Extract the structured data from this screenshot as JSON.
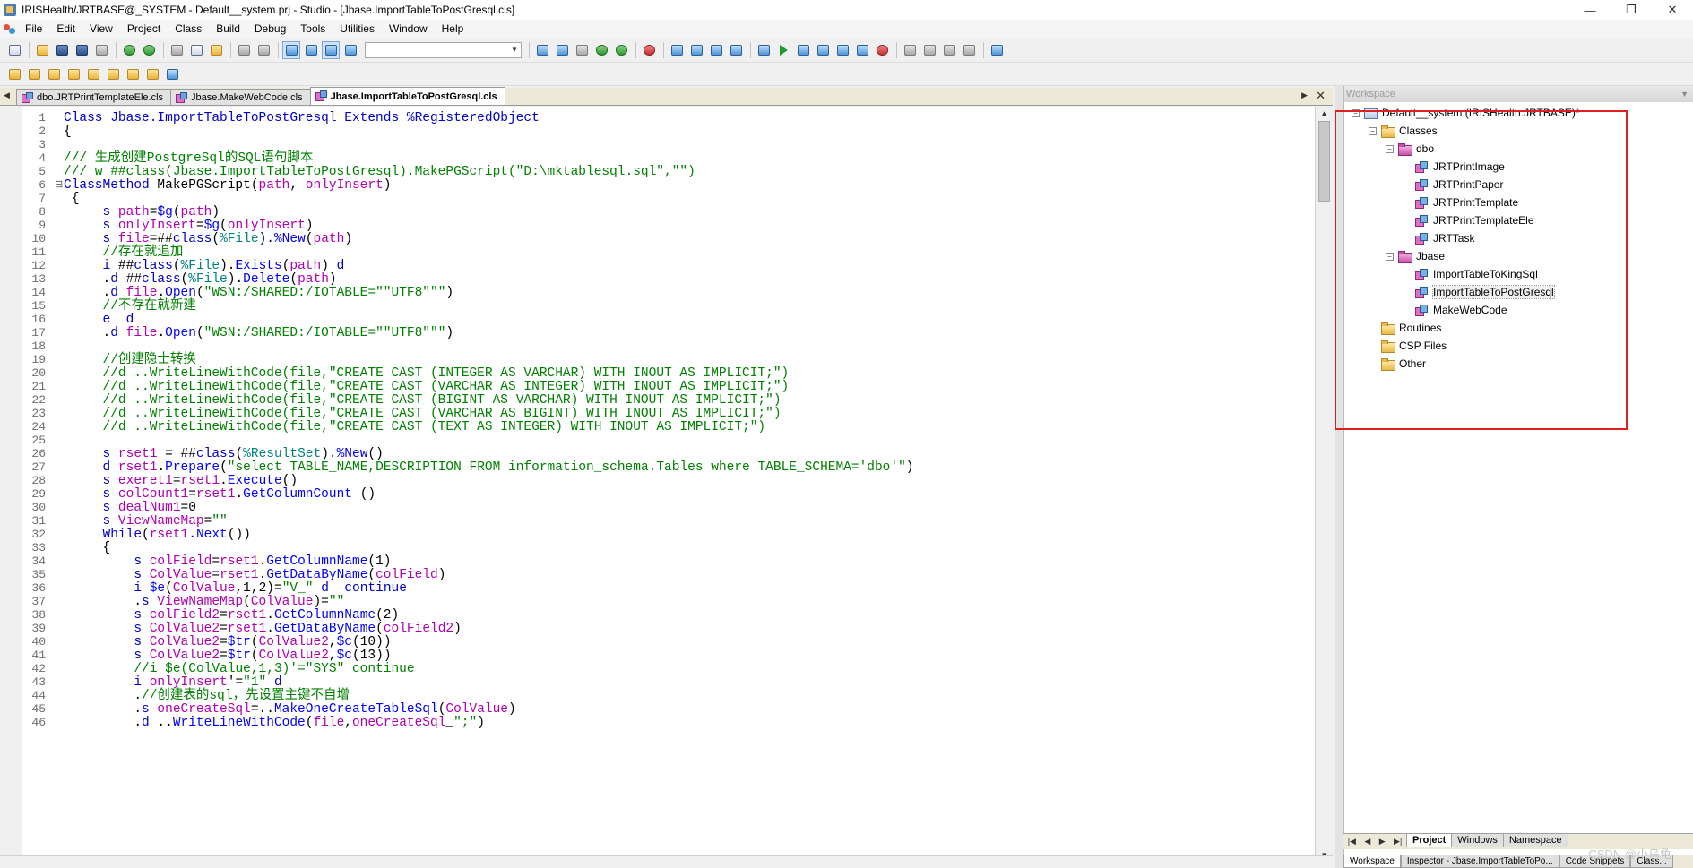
{
  "window": {
    "title": "IRISHealth/JRTBASE@_SYSTEM - Default__system.prj - Studio - [Jbase.ImportTableToPostGresql.cls]",
    "minimize": "—",
    "restore": "❐",
    "close": "✕"
  },
  "menu": [
    "File",
    "Edit",
    "View",
    "Project",
    "Class",
    "Build",
    "Debug",
    "Tools",
    "Utilities",
    "Window",
    "Help"
  ],
  "editor_tabs": [
    {
      "label": "dbo.JRTPrintTemplateEle.cls",
      "active": false
    },
    {
      "label": "Jbase.MakeWebCode.cls",
      "active": false
    },
    {
      "label": "Jbase.ImportTableToPostGresql.cls",
      "active": true
    }
  ],
  "workspace": {
    "header": "Workspace",
    "tree": [
      {
        "label": "Default__system  (IRISHealth:JRTBASE)*",
        "level": 0,
        "icon": "project-icon",
        "expander": "⊟"
      },
      {
        "label": "Classes",
        "level": 1,
        "icon": "folder-icon",
        "expander": "⊟"
      },
      {
        "label": "dbo",
        "level": 2,
        "icon": "package-icon",
        "expander": "⊟"
      },
      {
        "label": "JRTPrintImage",
        "level": 3,
        "icon": "class-icon"
      },
      {
        "label": "JRTPrintPaper",
        "level": 3,
        "icon": "class-icon"
      },
      {
        "label": "JRTPrintTemplate",
        "level": 3,
        "icon": "class-icon"
      },
      {
        "label": "JRTPrintTemplateEle",
        "level": 3,
        "icon": "class-icon"
      },
      {
        "label": "JRTTask",
        "level": 3,
        "icon": "class-icon"
      },
      {
        "label": "Jbase",
        "level": 2,
        "icon": "package-icon",
        "expander": "⊟"
      },
      {
        "label": "ImportTableToKingSql",
        "level": 3,
        "icon": "class-icon"
      },
      {
        "label": "ImportTableToPostGresql",
        "level": 3,
        "icon": "class-icon",
        "selected": true
      },
      {
        "label": "MakeWebCode",
        "level": 3,
        "icon": "class-icon"
      },
      {
        "label": "Routines",
        "level": 1,
        "icon": "folder-icon"
      },
      {
        "label": "CSP Files",
        "level": 1,
        "icon": "folder-icon"
      },
      {
        "label": "Other",
        "level": 1,
        "icon": "folder-icon"
      }
    ],
    "bottom_tabs": [
      {
        "label": "Project",
        "active": true
      },
      {
        "label": "Windows",
        "active": false
      },
      {
        "label": "Namespace",
        "active": false
      }
    ],
    "panel_tabs": [
      {
        "label": "Workspace",
        "active": true
      },
      {
        "label": "Inspector - Jbase.ImportTableToPo...",
        "active": false
      },
      {
        "label": "Code Snippets",
        "active": false
      },
      {
        "label": "Class...",
        "active": false
      }
    ]
  },
  "watermark": "CSDN @小乌龟",
  "code_lines": [
    [
      [
        "k",
        "Class Jbase.ImportTableToPostGresql Extends %RegisteredObject"
      ]
    ],
    [
      [
        "n",
        "{"
      ]
    ],
    [],
    [
      [
        "c",
        "/// 生成创建PostgreSql的SQL语句脚本"
      ]
    ],
    [
      [
        "c",
        "/// w ##class(Jbase.ImportTableToPostGresql).MakePGScript(\"D:\\mktablesql.sql\",\"\")"
      ]
    ],
    [
      [
        "k",
        "ClassMethod "
      ],
      [
        "n",
        "MakePGScript("
      ],
      [
        "v",
        "path"
      ],
      [
        "n",
        ", "
      ],
      [
        "v",
        "onlyInsert"
      ],
      [
        "n",
        ")"
      ]
    ],
    [
      [
        "n",
        " {"
      ]
    ],
    [
      [
        "n",
        "     "
      ],
      [
        "k",
        "s "
      ],
      [
        "v",
        "path"
      ],
      [
        "n",
        "="
      ],
      [
        "m",
        "$g"
      ],
      [
        "n",
        "("
      ],
      [
        "v",
        "path"
      ],
      [
        "n",
        ")"
      ]
    ],
    [
      [
        "n",
        "     "
      ],
      [
        "k",
        "s "
      ],
      [
        "v",
        "onlyInsert"
      ],
      [
        "n",
        "="
      ],
      [
        "m",
        "$g"
      ],
      [
        "n",
        "("
      ],
      [
        "v",
        "onlyInsert"
      ],
      [
        "n",
        ")"
      ]
    ],
    [
      [
        "n",
        "     "
      ],
      [
        "k",
        "s "
      ],
      [
        "v",
        "file"
      ],
      [
        "n",
        "=##"
      ],
      [
        "k",
        "class"
      ],
      [
        "n",
        "("
      ],
      [
        "f",
        "%File"
      ],
      [
        "n",
        ")."
      ],
      [
        "m",
        "%New"
      ],
      [
        "n",
        "("
      ],
      [
        "v",
        "path"
      ],
      [
        "n",
        ")"
      ]
    ],
    [
      [
        "n",
        "     "
      ],
      [
        "c",
        "//存在就追加"
      ]
    ],
    [
      [
        "n",
        "     "
      ],
      [
        "k",
        "i "
      ],
      [
        "n",
        "##"
      ],
      [
        "k",
        "class"
      ],
      [
        "n",
        "("
      ],
      [
        "f",
        "%File"
      ],
      [
        "n",
        ")."
      ],
      [
        "m",
        "Exists"
      ],
      [
        "n",
        "("
      ],
      [
        "v",
        "path"
      ],
      [
        "n",
        ") "
      ],
      [
        "k",
        "d"
      ]
    ],
    [
      [
        "n",
        "     ."
      ],
      [
        "k",
        "d "
      ],
      [
        "n",
        "##"
      ],
      [
        "k",
        "class"
      ],
      [
        "n",
        "("
      ],
      [
        "f",
        "%File"
      ],
      [
        "n",
        ")."
      ],
      [
        "m",
        "Delete"
      ],
      [
        "n",
        "("
      ],
      [
        "v",
        "path"
      ],
      [
        "n",
        ")"
      ]
    ],
    [
      [
        "n",
        "     ."
      ],
      [
        "k",
        "d "
      ],
      [
        "v",
        "file"
      ],
      [
        "n",
        "."
      ],
      [
        "m",
        "Open"
      ],
      [
        "n",
        "("
      ],
      [
        "s",
        "\"WSN:/SHARED:/IOTABLE=\"\"UTF8\"\"\""
      ],
      [
        "n",
        ")"
      ]
    ],
    [
      [
        "n",
        "     "
      ],
      [
        "c",
        "//不存在就新建"
      ]
    ],
    [
      [
        "n",
        "     "
      ],
      [
        "k",
        "e  d"
      ]
    ],
    [
      [
        "n",
        "     ."
      ],
      [
        "k",
        "d "
      ],
      [
        "v",
        "file"
      ],
      [
        "n",
        "."
      ],
      [
        "m",
        "Open"
      ],
      [
        "n",
        "("
      ],
      [
        "s",
        "\"WSN:/SHARED:/IOTABLE=\"\"UTF8\"\"\""
      ],
      [
        "n",
        ")"
      ]
    ],
    [],
    [
      [
        "n",
        "     "
      ],
      [
        "c",
        "//创建隐士转换"
      ]
    ],
    [
      [
        "n",
        "     "
      ],
      [
        "c",
        "//d ..WriteLineWithCode(file,\"CREATE CAST (INTEGER AS VARCHAR) WITH INOUT AS IMPLICIT;\")"
      ]
    ],
    [
      [
        "n",
        "     "
      ],
      [
        "c",
        "//d ..WriteLineWithCode(file,\"CREATE CAST (VARCHAR AS INTEGER) WITH INOUT AS IMPLICIT;\")"
      ]
    ],
    [
      [
        "n",
        "     "
      ],
      [
        "c",
        "//d ..WriteLineWithCode(file,\"CREATE CAST (BIGINT AS VARCHAR) WITH INOUT AS IMPLICIT;\")"
      ]
    ],
    [
      [
        "n",
        "     "
      ],
      [
        "c",
        "//d ..WriteLineWithCode(file,\"CREATE CAST (VARCHAR AS BIGINT) WITH INOUT AS IMPLICIT;\")"
      ]
    ],
    [
      [
        "n",
        "     "
      ],
      [
        "c",
        "//d ..WriteLineWithCode(file,\"CREATE CAST (TEXT AS INTEGER) WITH INOUT AS IMPLICIT;\")"
      ]
    ],
    [],
    [
      [
        "n",
        "     "
      ],
      [
        "k",
        "s "
      ],
      [
        "v",
        "rset1"
      ],
      [
        "n",
        " = ##"
      ],
      [
        "k",
        "class"
      ],
      [
        "n",
        "("
      ],
      [
        "f",
        "%ResultSet"
      ],
      [
        "n",
        ")."
      ],
      [
        "m",
        "%New"
      ],
      [
        "n",
        "()"
      ]
    ],
    [
      [
        "n",
        "     "
      ],
      [
        "k",
        "d "
      ],
      [
        "v",
        "rset1"
      ],
      [
        "n",
        "."
      ],
      [
        "m",
        "Prepare"
      ],
      [
        "n",
        "("
      ],
      [
        "s",
        "\"select TABLE_NAME,DESCRIPTION FROM information_schema.Tables where TABLE_SCHEMA='dbo'\""
      ],
      [
        "n",
        ")"
      ]
    ],
    [
      [
        "n",
        "     "
      ],
      [
        "k",
        "s "
      ],
      [
        "v",
        "exeret1"
      ],
      [
        "n",
        "="
      ],
      [
        "v",
        "rset1"
      ],
      [
        "n",
        "."
      ],
      [
        "m",
        "Execute"
      ],
      [
        "n",
        "()"
      ]
    ],
    [
      [
        "n",
        "     "
      ],
      [
        "k",
        "s "
      ],
      [
        "v",
        "colCount1"
      ],
      [
        "n",
        "="
      ],
      [
        "v",
        "rset1"
      ],
      [
        "n",
        "."
      ],
      [
        "m",
        "GetColumnCount"
      ],
      [
        "n",
        " ()"
      ]
    ],
    [
      [
        "n",
        "     "
      ],
      [
        "k",
        "s "
      ],
      [
        "v",
        "dealNum1"
      ],
      [
        "n",
        "=0"
      ]
    ],
    [
      [
        "n",
        "     "
      ],
      [
        "k",
        "s "
      ],
      [
        "v",
        "ViewNameMap"
      ],
      [
        "n",
        "="
      ],
      [
        "s",
        "\"\""
      ]
    ],
    [
      [
        "n",
        "     "
      ],
      [
        "k",
        "While"
      ],
      [
        "n",
        "("
      ],
      [
        "v",
        "rset1"
      ],
      [
        "n",
        "."
      ],
      [
        "m",
        "Next"
      ],
      [
        "n",
        "())"
      ]
    ],
    [
      [
        "n",
        "     {"
      ]
    ],
    [
      [
        "n",
        "         "
      ],
      [
        "k",
        "s "
      ],
      [
        "v",
        "colField"
      ],
      [
        "n",
        "="
      ],
      [
        "v",
        "rset1"
      ],
      [
        "n",
        "."
      ],
      [
        "m",
        "GetColumnName"
      ],
      [
        "n",
        "(1)"
      ]
    ],
    [
      [
        "n",
        "         "
      ],
      [
        "k",
        "s "
      ],
      [
        "v",
        "ColValue"
      ],
      [
        "n",
        "="
      ],
      [
        "v",
        "rset1"
      ],
      [
        "n",
        "."
      ],
      [
        "m",
        "GetDataByName"
      ],
      [
        "n",
        "("
      ],
      [
        "v",
        "colField"
      ],
      [
        "n",
        ")"
      ]
    ],
    [
      [
        "n",
        "         "
      ],
      [
        "k",
        "i "
      ],
      [
        "m",
        "$e"
      ],
      [
        "n",
        "("
      ],
      [
        "v",
        "ColValue"
      ],
      [
        "n",
        ",1,2)="
      ],
      [
        "s",
        "\"V_\""
      ],
      [
        "n",
        " "
      ],
      [
        "k",
        "d"
      ],
      [
        "n",
        "  "
      ],
      [
        "k",
        "continue"
      ]
    ],
    [
      [
        "n",
        "         ."
      ],
      [
        "k",
        "s "
      ],
      [
        "v",
        "ViewNameMap"
      ],
      [
        "n",
        "("
      ],
      [
        "v",
        "ColValue"
      ],
      [
        "n",
        ")="
      ],
      [
        "s",
        "\"\""
      ]
    ],
    [
      [
        "n",
        "         "
      ],
      [
        "k",
        "s "
      ],
      [
        "v",
        "colField2"
      ],
      [
        "n",
        "="
      ],
      [
        "v",
        "rset1"
      ],
      [
        "n",
        "."
      ],
      [
        "m",
        "GetColumnName"
      ],
      [
        "n",
        "(2)"
      ]
    ],
    [
      [
        "n",
        "         "
      ],
      [
        "k",
        "s "
      ],
      [
        "v",
        "ColValue2"
      ],
      [
        "n",
        "="
      ],
      [
        "v",
        "rset1"
      ],
      [
        "n",
        "."
      ],
      [
        "m",
        "GetDataByName"
      ],
      [
        "n",
        "("
      ],
      [
        "v",
        "colField2"
      ],
      [
        "n",
        ")"
      ]
    ],
    [
      [
        "n",
        "         "
      ],
      [
        "k",
        "s "
      ],
      [
        "v",
        "ColValue2"
      ],
      [
        "n",
        "="
      ],
      [
        "m",
        "$tr"
      ],
      [
        "n",
        "("
      ],
      [
        "v",
        "ColValue2"
      ],
      [
        "n",
        ","
      ],
      [
        "m",
        "$c"
      ],
      [
        "n",
        "(10))"
      ]
    ],
    [
      [
        "n",
        "         "
      ],
      [
        "k",
        "s "
      ],
      [
        "v",
        "ColValue2"
      ],
      [
        "n",
        "="
      ],
      [
        "m",
        "$tr"
      ],
      [
        "n",
        "("
      ],
      [
        "v",
        "ColValue2"
      ],
      [
        "n",
        ","
      ],
      [
        "m",
        "$c"
      ],
      [
        "n",
        "(13))"
      ]
    ],
    [
      [
        "n",
        "         "
      ],
      [
        "c",
        "//i $e(ColValue,1,3)'=\"SYS\" continue"
      ]
    ],
    [
      [
        "n",
        "         "
      ],
      [
        "k",
        "i "
      ],
      [
        "v",
        "onlyInsert"
      ],
      [
        "n",
        "'="
      ],
      [
        "s",
        "\"1\""
      ],
      [
        "n",
        " "
      ],
      [
        "k",
        "d"
      ]
    ],
    [
      [
        "n",
        "         ."
      ],
      [
        "c",
        "//创建表的sql，先设置主键不自增"
      ]
    ],
    [
      [
        "n",
        "         ."
      ],
      [
        "k",
        "s "
      ],
      [
        "v",
        "oneCreateSql"
      ],
      [
        "n",
        "=.."
      ],
      [
        "m",
        "MakeOneCreateTableSql"
      ],
      [
        "n",
        "("
      ],
      [
        "v",
        "ColValue"
      ],
      [
        "n",
        ")"
      ]
    ],
    [
      [
        "n",
        "         ."
      ],
      [
        "k",
        "d "
      ],
      [
        "n",
        ".."
      ],
      [
        "m",
        "WriteLineWithCode"
      ],
      [
        "n",
        "("
      ],
      [
        "v",
        "file"
      ],
      [
        "n",
        ","
      ],
      [
        "v",
        "oneCreateSql"
      ],
      [
        "n",
        "_"
      ],
      [
        "s",
        "\";\""
      ],
      [
        "n",
        ")"
      ]
    ]
  ]
}
